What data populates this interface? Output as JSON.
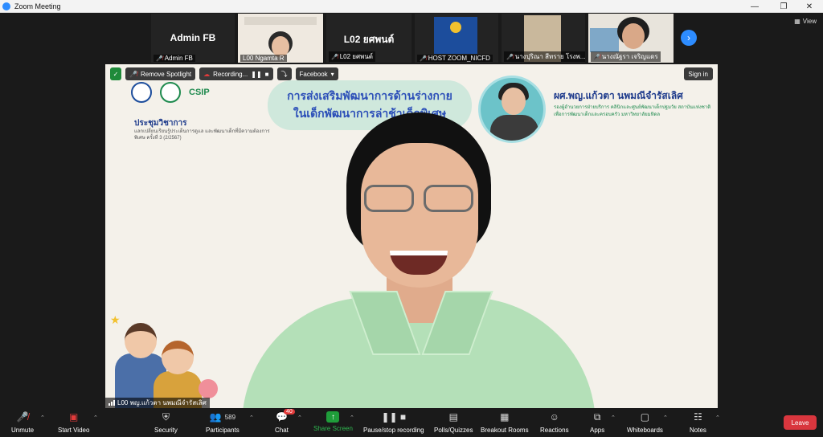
{
  "window": {
    "title": "Zoom Meeting"
  },
  "strip": {
    "view_label": "View",
    "tiles": [
      {
        "big_name": "Admin FB",
        "caption": "Admin FB"
      },
      {
        "big_name": "",
        "caption": "L00 Ngamta R"
      },
      {
        "big_name": "L02 ยศพนต์",
        "caption": "L02 ยศพนต์"
      },
      {
        "big_name": "",
        "caption": "HOST ZOOM_NICFD"
      },
      {
        "big_name": "",
        "caption": "นางปุริณา สีทราย โรงพ..."
      },
      {
        "big_name": "",
        "caption": "นางณัฐรา เจริญแดร"
      }
    ]
  },
  "main": {
    "overlay": {
      "remove_spotlight": "Remove Spotlight",
      "recording": "Recording...",
      "facebook": "Facebook",
      "sign_in": "Sign in"
    },
    "slide": {
      "csip": "CSIP",
      "conference_title": "ประชุมวิชาการ",
      "conference_sub": "แลกเปลี่ยนเรียนรู้ประเด็นการดูแล และพัฒนาเด็กที่มีความต้องการพิเศษ ครั้งที่ 3 (2/2567)",
      "banner_line1": "การส่งเสริมพัฒนาการด้านร่างกาย",
      "banner_line2": "ในเด็กพัฒนาการล่าช้าเด็กพิเศษ",
      "speaker_name": "ผศ.พญ.แก้วตา นพมณีจำรัสเลิศ",
      "speaker_role": "รองผู้อำนวยการฝ่ายบริการ คลินิกและศูนย์พัฒนาเด็กปฐมวัย สถาบันแห่งชาติเพื่อการพัฒนาเด็กและครอบครัว มหาวิทยาลัยมหิดล"
    },
    "speaker_tag": "L00 พญ.แก้วตา นพมณีจำรัสเลิศ"
  },
  "controls": {
    "unmute": "Unmute",
    "start_video": "Start Video",
    "security": "Security",
    "participants": "Participants",
    "participants_count": "589",
    "chat": "Chat",
    "chat_badge": "40",
    "share_screen": "Share Screen",
    "pause_recording": "Pause/stop recording",
    "polls": "Polls/Quizzes",
    "breakout": "Breakout Rooms",
    "reactions": "Reactions",
    "apps": "Apps",
    "whiteboards": "Whiteboards",
    "notes": "Notes",
    "leave": "Leave"
  },
  "colors": {
    "accent": "#2d8cff",
    "leave": "#d9363e",
    "share": "#1f9d3a"
  }
}
